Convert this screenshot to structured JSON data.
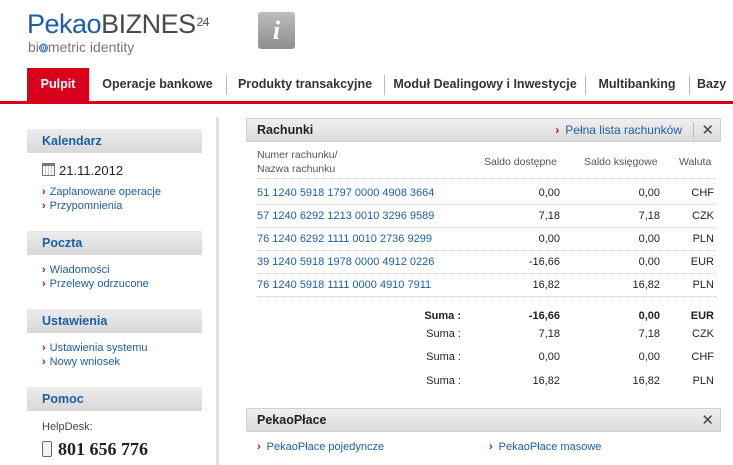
{
  "brand": {
    "name_part1": "Pekao",
    "name_part2": "BIZNES",
    "superscript": "24",
    "sub_part1": "bi",
    "sub_part2": "metric identity"
  },
  "info_button": {
    "glyph": "i"
  },
  "nav": {
    "tabs": [
      {
        "label": "Pulpit",
        "active": true
      },
      {
        "label": "Operacje bankowe"
      },
      {
        "label": "Produkty transakcyjne"
      },
      {
        "label": "Moduł Dealingowy i Inwestycje"
      },
      {
        "label": "Multibanking"
      },
      {
        "label": "Bazy"
      }
    ]
  },
  "sidebar": {
    "calendar": {
      "title": "Kalendarz",
      "date": "21.11.2012",
      "links": [
        "Zaplanowane operacje",
        "Przypomnienia"
      ]
    },
    "mail": {
      "title": "Poczta",
      "links": [
        "Wiadomości",
        "Przelewy odrzucone"
      ]
    },
    "settings": {
      "title": "Ustawienia",
      "links": [
        "Ustawienia systemu",
        "Nowy wniosek"
      ]
    },
    "help": {
      "title": "Pomoc",
      "helpdesk_label": "HelpDesk:",
      "phone": "801 656 776"
    }
  },
  "accounts_panel": {
    "title": "Rachunki",
    "full_list_link": "Pełna lista rachunków",
    "close": "✕",
    "columns": {
      "account_line1": "Numer rachunku/",
      "account_line2": "Nazwa rachunku",
      "available": "Saldo dostępne",
      "book": "Saldo księgowe",
      "currency": "Waluta"
    },
    "rows": [
      {
        "account": "51 1240 5918 1797 0000 4908 3664",
        "available": "0,00",
        "book": "0,00",
        "currency": "CHF"
      },
      {
        "account": "57 1240 6292 1213 0010 3296 9589",
        "available": "7,18",
        "book": "7,18",
        "currency": "CZK"
      },
      {
        "account": "76 1240 6292 1111 0010 2736 9299",
        "available": "0,00",
        "book": "0,00",
        "currency": "PLN"
      },
      {
        "account": "39 1240 5918 1978 0000 4912 0226",
        "available": "-16,66",
        "book": "0,00",
        "currency": "EUR"
      },
      {
        "account": "76 1240 5918 1111 0000 4910 7911",
        "available": "16,82",
        "book": "16,82",
        "currency": "PLN"
      }
    ],
    "sums": [
      {
        "label": "Suma :",
        "available": "-16,66",
        "book": "0,00",
        "currency": "EUR",
        "bold": true
      },
      {
        "label": "Suma :",
        "available": "7,18",
        "book": "7,18",
        "currency": "CZK"
      },
      {
        "label": "Suma :",
        "available": "0,00",
        "book": "0,00",
        "currency": "CHF"
      },
      {
        "label": "Suma :",
        "available": "16,82",
        "book": "16,82",
        "currency": "PLN"
      }
    ]
  },
  "payroll_panel": {
    "title": "PekaoPłace",
    "close": "✕",
    "links": [
      "PekaoPłace pojedyncze",
      "PekaoPłace masowe"
    ]
  },
  "colors": {
    "accent_red": "#d9001b",
    "link_blue": "#1d5ea8"
  }
}
